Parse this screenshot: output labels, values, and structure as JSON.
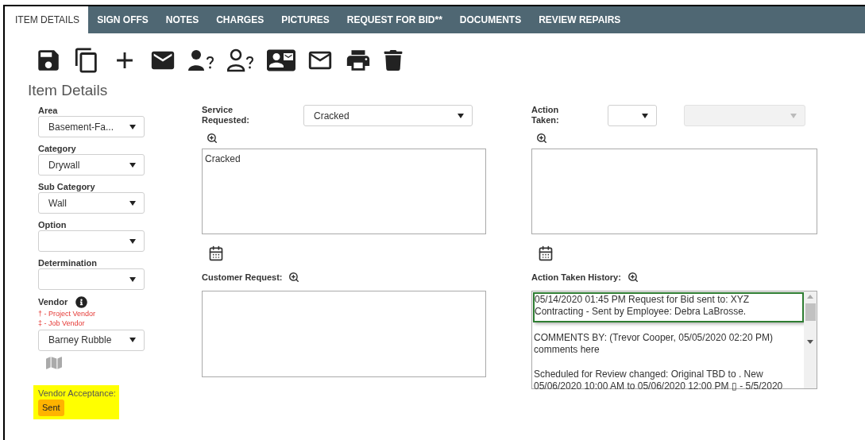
{
  "tabs": [
    {
      "label": "ITEM DETAILS",
      "selected": true
    },
    {
      "label": "SIGN OFFS",
      "selected": false
    },
    {
      "label": "NOTES",
      "selected": false
    },
    {
      "label": "CHARGES",
      "selected": false
    },
    {
      "label": "PICTURES",
      "selected": false
    },
    {
      "label": "REQUEST FOR BID**",
      "selected": false
    },
    {
      "label": "DOCUMENTS",
      "selected": false
    },
    {
      "label": "REVIEW REPAIRS",
      "selected": false
    }
  ],
  "title": "Item Details",
  "left_fields": [
    {
      "label": "Area",
      "value": "Basement-Fa..."
    },
    {
      "label": "Category",
      "value": "Drywall"
    },
    {
      "label": "Sub Category",
      "value": "Wall"
    },
    {
      "label": "Option"
    },
    {
      "label": "Determination"
    }
  ],
  "vendor": {
    "label": "Vendor",
    "legend": [
      "† - Project Vendor",
      "‡ - Job Vendor"
    ],
    "value": "Barney Rubble"
  },
  "vendor_acceptance": {
    "label": "Vendor Acceptance:",
    "status": "Sent"
  },
  "service_requested": {
    "label": "Service Requested:",
    "value": "Cracked",
    "text": "Cracked"
  },
  "action_taken": {
    "label": "Action Taken:",
    "secondary_disabled": true
  },
  "customer_request": {
    "label": "Customer Request:"
  },
  "history": {
    "label": "Action Taken History:",
    "entries": [
      {
        "text": "05/14/2020 01:45 PM Request for Bid sent to: XYZ Contracting - Sent by Employee: Debra LaBrosse.",
        "highlighted": true
      },
      {
        "text": "COMMENTS BY: (Trevor Cooper, 05/05/2020 02:20 PM) comments here",
        "highlighted": false
      },
      {
        "text": "Scheduled for Review changed:  Original TBD  to  .  New 05/06/2020 10:00 AM to 05/06/2020 12:00 PM  ▯ - 5/5/2020",
        "highlighted": false
      }
    ]
  }
}
